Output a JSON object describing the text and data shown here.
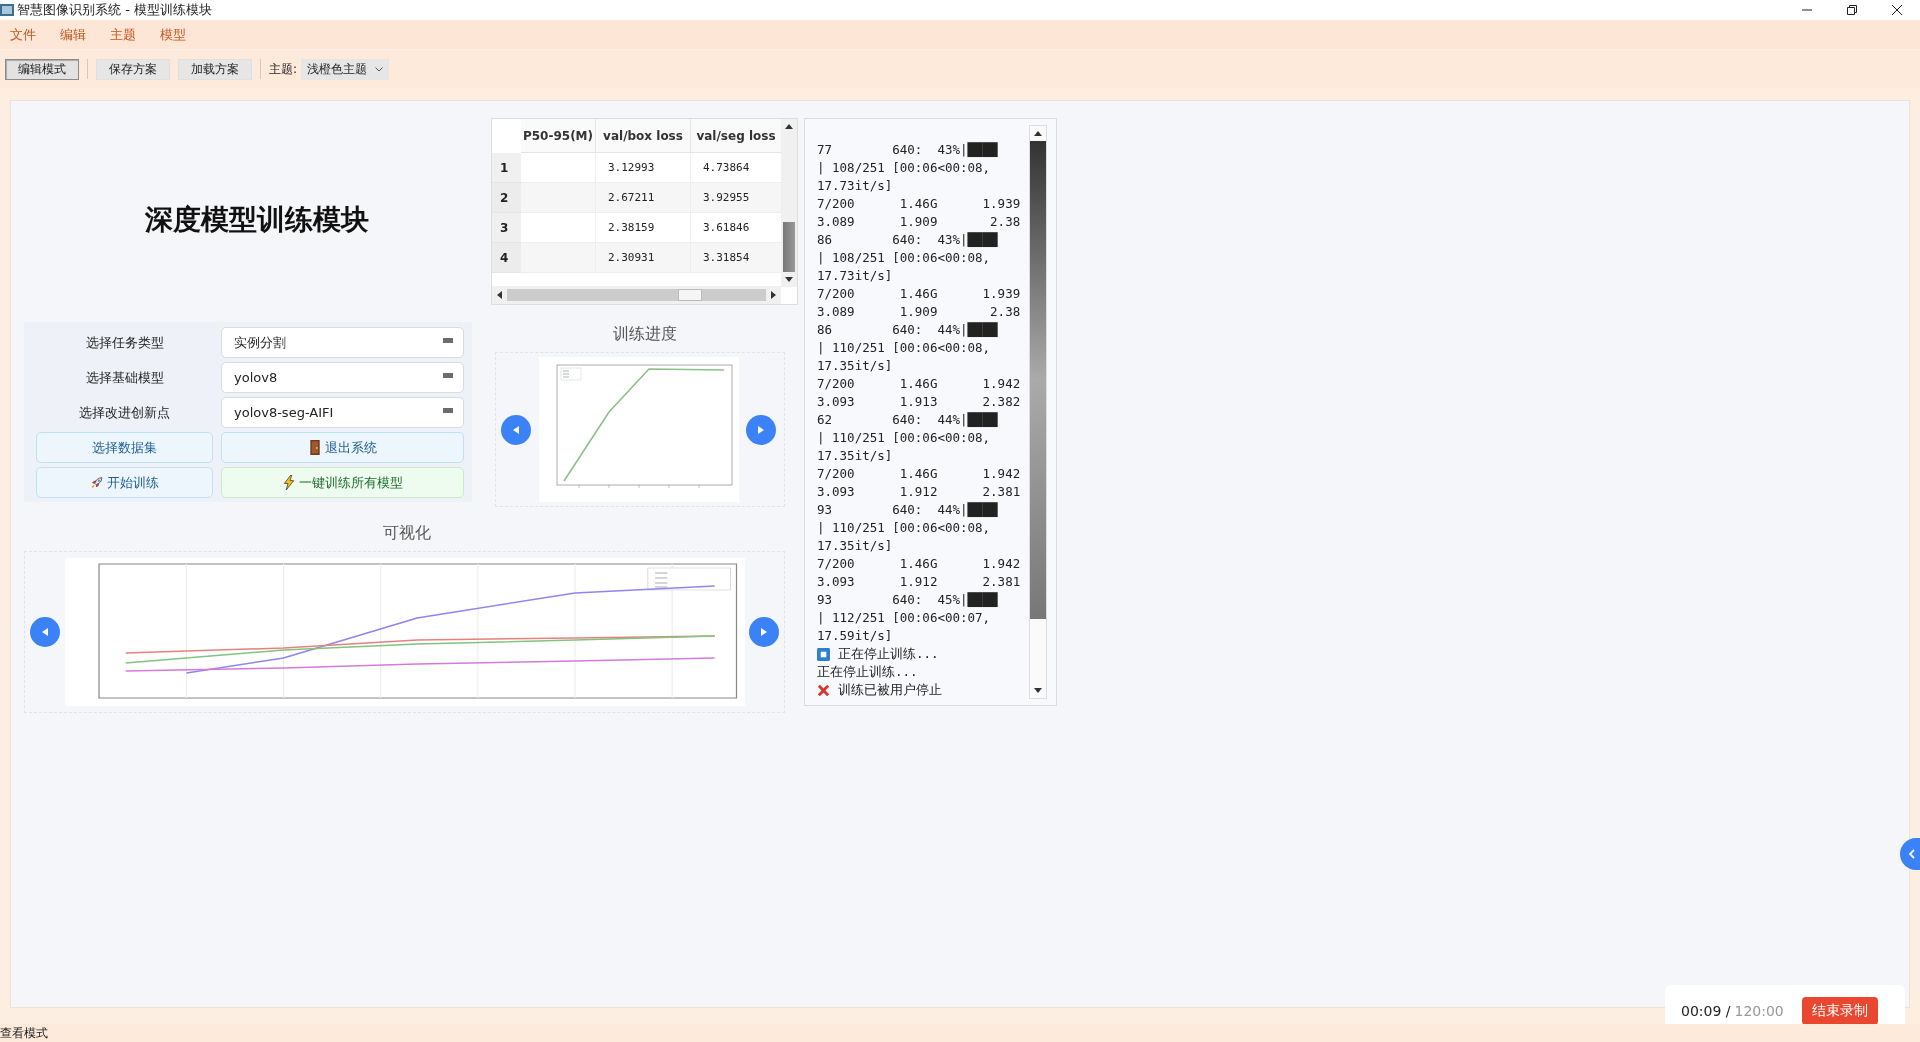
{
  "window": {
    "title": "智慧图像识别系统 - 模型训练模块"
  },
  "menu": [
    "文件",
    "编辑",
    "主题",
    "模型"
  ],
  "toolbar": {
    "buttons": [
      {
        "label": "编辑模式",
        "checked": true
      },
      {
        "label": "保存方案",
        "checked": false
      },
      {
        "label": "加载方案",
        "checked": false
      }
    ],
    "theme_label": "主题:",
    "theme_value": "浅橙色主题"
  },
  "heading": "深度模型训练模块",
  "form": [
    {
      "label": "选择任务类型",
      "value": "实例分割"
    },
    {
      "label": "选择基础模型",
      "value": "yolov8"
    },
    {
      "label": "选择改进创新点",
      "value": "yolov8-seg-AIFI"
    }
  ],
  "actions": [
    {
      "label": "选择数据集",
      "kind": "plain"
    },
    {
      "label": "退出系统",
      "kind": "exit"
    },
    {
      "label": "开始训练",
      "kind": "start"
    },
    {
      "label": "一键训练所有模型",
      "kind": "train-all"
    }
  ],
  "table": {
    "columns": [
      "P50-95(M)",
      "val/box loss",
      "val/seg loss"
    ],
    "rows": [
      {
        "index": "1",
        "values": [
          "3.12993",
          "4.73864"
        ]
      },
      {
        "index": "2",
        "values": [
          "2.67211",
          "3.92955"
        ]
      },
      {
        "index": "3",
        "values": [
          "2.38159",
          "3.61846"
        ]
      },
      {
        "index": "4",
        "values": [
          "2.30931",
          "3.31854"
        ]
      }
    ]
  },
  "progress": {
    "title": "训练进度"
  },
  "visualization": {
    "title": "可视化"
  },
  "log": {
    "lines": [
      "77        640:  43%|████",
      "| 108/251 [00:06<00:08,",
      "17.73it/s]",
      "7/200      1.46G      1.939",
      "3.089      1.909       2.38",
      "86        640:  43%|████",
      "| 108/251 [00:06<00:08,",
      "17.73it/s]",
      "7/200      1.46G      1.939",
      "3.089      1.909       2.38",
      "86        640:  44%|████",
      "| 110/251 [00:06<00:08,",
      "17.35it/s]",
      "7/200      1.46G      1.942",
      "3.093      1.913      2.382",
      "62        640:  44%|████",
      "| 110/251 [00:06<00:08,",
      "17.35it/s]",
      "7/200      1.46G      1.942",
      "3.093      1.912      2.381",
      "93        640:  44%|████",
      "| 110/251 [00:06<00:08,",
      "17.35it/s]",
      "7/200      1.46G      1.942",
      "3.093      1.912      2.381",
      "93        640:  45%|████",
      "| 112/251 [00:06<00:07,",
      "17.59it/s]"
    ],
    "events": [
      {
        "kind": "stopping",
        "text": "正在停止训练..."
      },
      {
        "kind": "plain",
        "text": "正在停止训练..."
      },
      {
        "kind": "stopped",
        "text": "训练已被用户停止"
      }
    ]
  },
  "recording": {
    "elapsed": "00:09 /",
    "limit": "120:00",
    "button": "结束录制"
  },
  "status_bar": "查看模式"
}
